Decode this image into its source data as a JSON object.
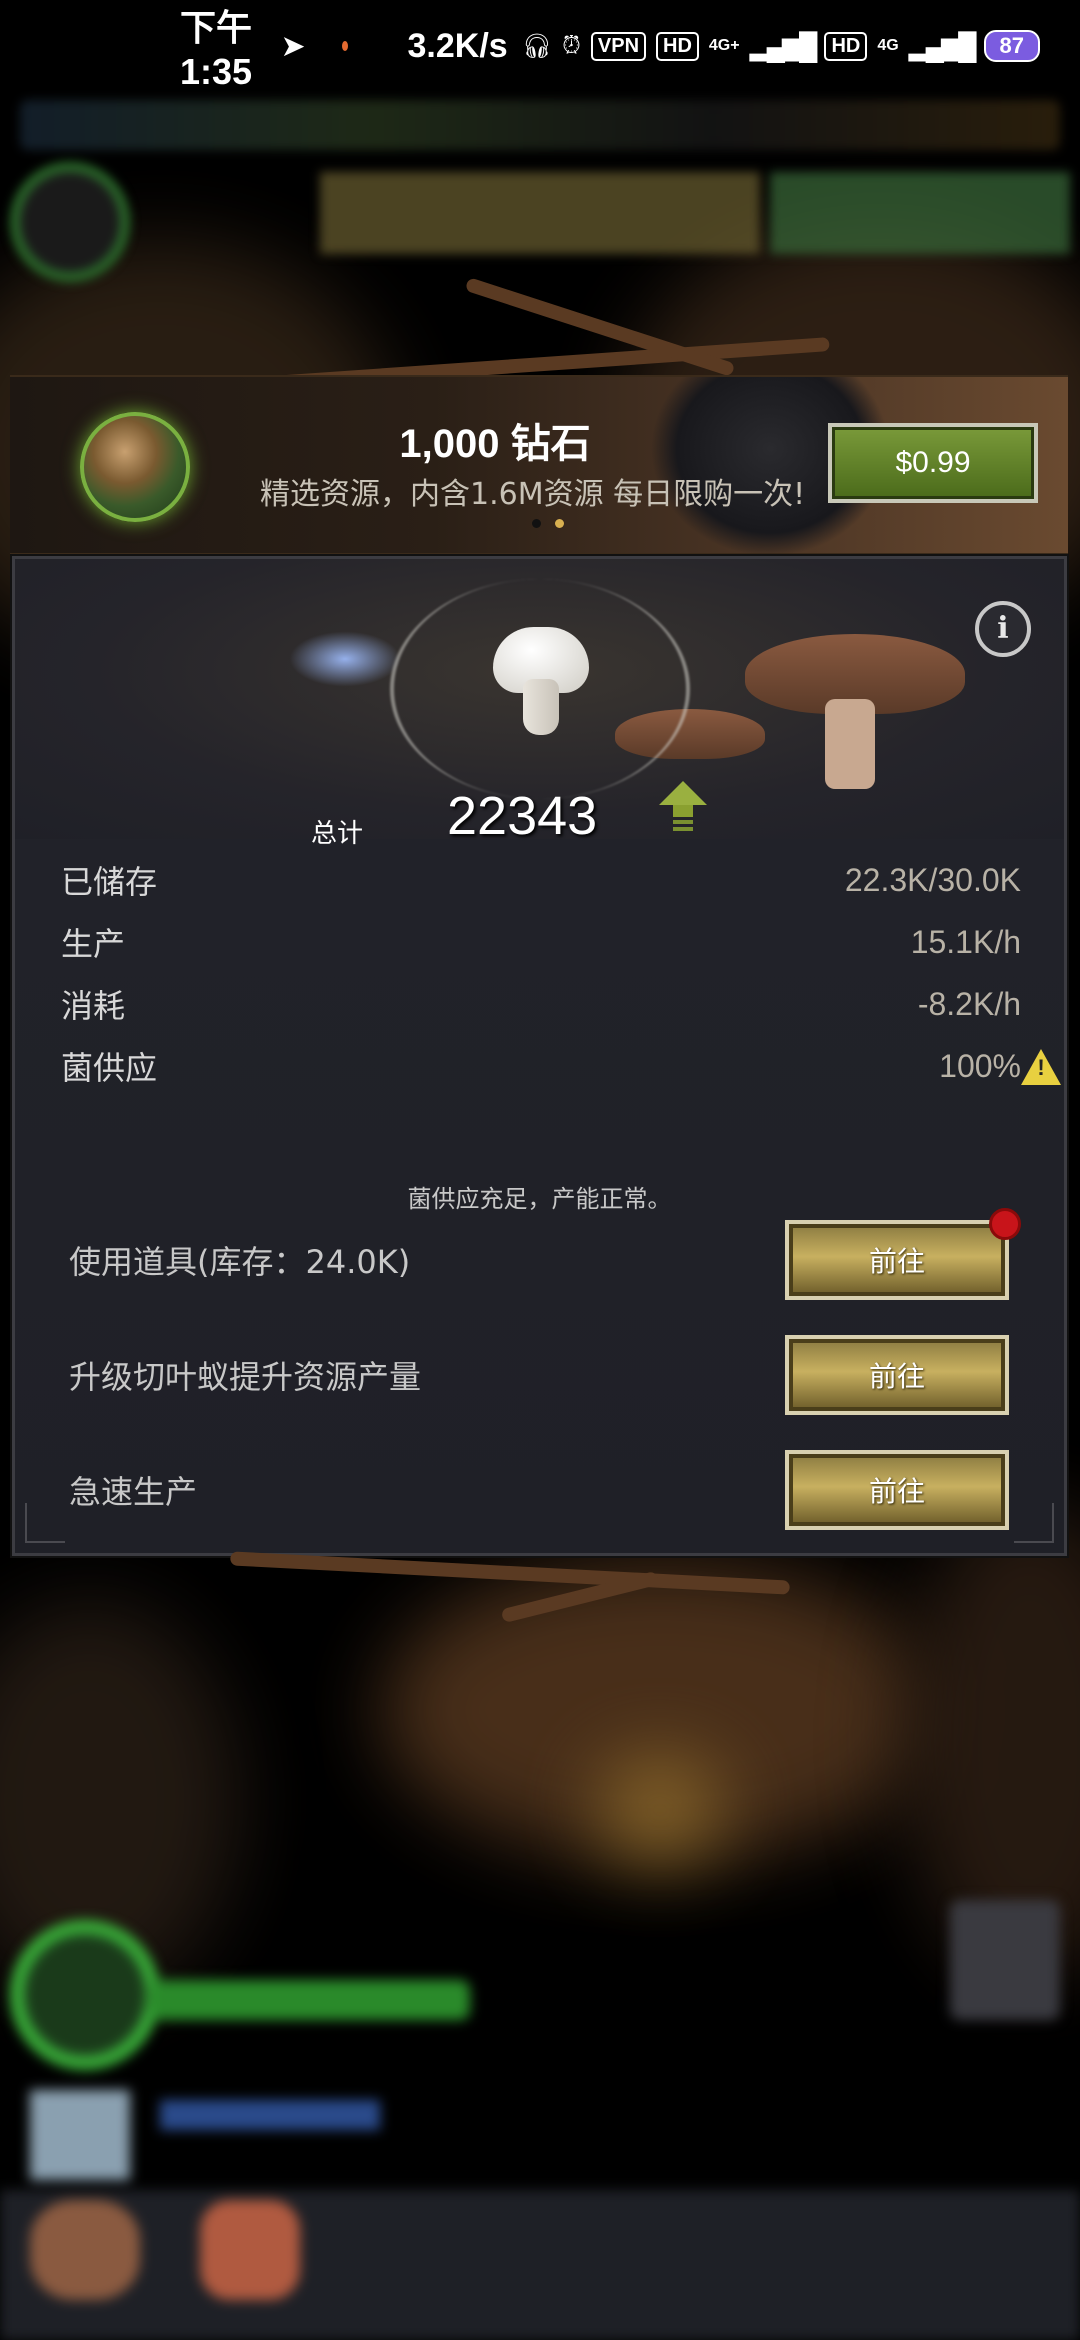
{
  "status_bar": {
    "time": "下午1:35",
    "speed": "3.2K/s",
    "vpn": "VPN",
    "hd1": "HD",
    "net1": "4G+",
    "hd2": "HD",
    "net2": "4G",
    "battery": "87"
  },
  "banner": {
    "title": "1,000 钻石",
    "subtitle": "精选资源，内含1.6M资源 每日限购一次!",
    "price": "$0.99",
    "active_dot": 1
  },
  "panel": {
    "info_icon": "i",
    "total_label": "总计",
    "total_value": "22343",
    "stats": [
      {
        "label": "已储存",
        "value": "22.3K/30.0K"
      },
      {
        "label": "生产",
        "value": "15.1K/h"
      },
      {
        "label": "消耗",
        "value": "-8.2K/h"
      },
      {
        "label": "菌供应",
        "value": "100%",
        "warning": true
      }
    ],
    "status_message": "菌供应充足，产能正常。",
    "actions": [
      {
        "label": "使用道具(库存：24.0K)",
        "button": "前往",
        "badge": true
      },
      {
        "label": "升级切叶蚁提升资源产量",
        "button": "前往",
        "badge": false
      },
      {
        "label": "急速生产",
        "button": "前往",
        "badge": false
      }
    ]
  },
  "colors": {
    "accent_gold": "#c8b060",
    "price_green": "#6a8a2a",
    "warning_yellow": "#e8d040",
    "badge_red": "#c8141a"
  },
  "icons": {
    "resource": "mushroom-icon",
    "up": "up-arrow-icon",
    "warning": "warning-icon",
    "info": "info-icon"
  }
}
